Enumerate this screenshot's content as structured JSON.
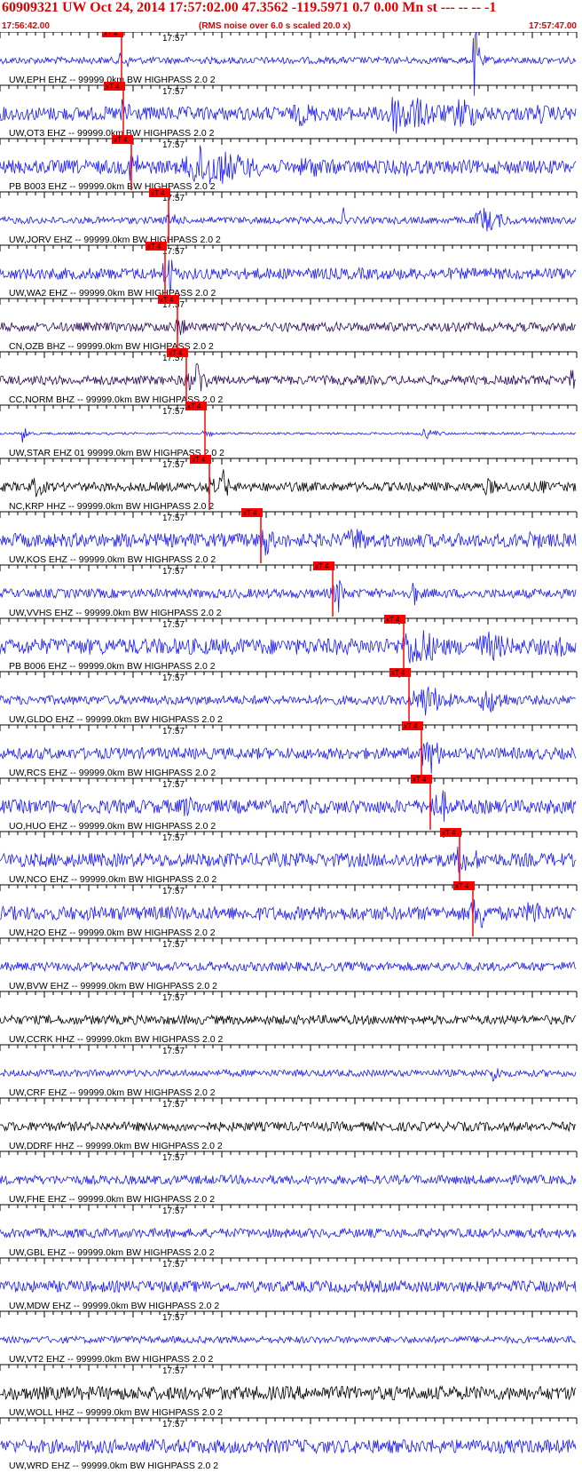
{
  "header": {
    "title": "60909321 UW Oct 24, 2014 17:57:02.00   47.3562 -119.5971  0.7 0.00 Mn st --- -- --  -1",
    "start_time": "17:56:42.00",
    "note": "(RMS noise over 6.0 s scaled 20.0 x)",
    "end_time": "17:57:47.00"
  },
  "chart_data": {
    "type": "line",
    "title": "60909321 UW Oct 24, 2014 17:57:02.00   47.3562 -119.5971  0.7 0.00 Mn st --- -- --  -1",
    "x_unit": "seconds after 17:56:42.00",
    "x_range": [
      0,
      65
    ],
    "minute_tick_label": "17:57",
    "minute_tick_offset_s": 18,
    "pick_label": "xT 4",
    "colors": {
      "blue": "#1a1aff",
      "red": "#ff0000",
      "black": "#000000",
      "purple": "#2a0a5a"
    },
    "traces": [
      {
        "label": "UW,EPH EHZ -- 99999.0km BW  HIGHPASS  2.0  2",
        "color": "blue",
        "pick_s": 13.7,
        "amplitude": 0.15,
        "bursts": [
          [
            53.5,
            0.5,
            1.8
          ]
        ]
      },
      {
        "label": "UW,OT3 EHZ -- 99999.0km BW  HIGHPASS  2.0  2",
        "color": "blue",
        "pick_s": 13.9,
        "amplitude": 0.3,
        "bursts": [
          [
            34,
            3.5,
            0.55
          ],
          [
            45,
            5,
            1.0
          ],
          [
            52,
            3,
            0.8
          ],
          [
            61,
            3,
            0.45
          ]
        ]
      },
      {
        "label": "PB B003 EHZ -- 99999.0km BW  HIGHPASS  2.0  2",
        "color": "blue",
        "pick_s": 14.8,
        "amplitude": 0.3,
        "bursts": [
          [
            23,
            6,
            1.0
          ],
          [
            35,
            5,
            0.5
          ],
          [
            46,
            4,
            0.4
          ]
        ]
      },
      {
        "label": "UW,JORV EHZ -- 99999.0km BW  HIGHPASS  2.0  2",
        "color": "blue",
        "pick_s": 19.0,
        "amplitude": 0.15,
        "bursts": [
          [
            19.5,
            0.6,
            0.5
          ],
          [
            38.7,
            0.3,
            0.6
          ],
          [
            54.5,
            2.5,
            0.6
          ]
        ]
      },
      {
        "label": "UW,WA2 EHZ -- 99999.0km BW  HIGHPASS  2.0  2",
        "color": "blue",
        "pick_s": 18.6,
        "amplitude": 0.25,
        "bursts": [
          [
            19,
            0.5,
            1.3
          ]
        ]
      },
      {
        "label": "CN,OZB BHZ -- 99999.0km BW  HIGHPASS  2.0  2",
        "color": "purple",
        "pick_s": 20.0,
        "amplitude": 0.2,
        "bursts": []
      },
      {
        "label": "CC,NORM BHZ -- 99999.0km BW  HIGHPASS  2.0  2",
        "color": "purple",
        "pick_s": 21.0,
        "amplitude": 0.2,
        "bursts": [
          [
            22.3,
            0.9,
            1.0
          ],
          [
            64.5,
            0.6,
            0.8
          ]
        ]
      },
      {
        "label": "UW,STAR EHZ 01 99999.0km BW  HIGHPASS  2.0  2",
        "color": "blue",
        "pick_s": 23.1,
        "amplitude": 0.05,
        "bursts": [
          [
            2.6,
            0.5,
            0.5
          ],
          [
            48,
            1.5,
            0.25
          ]
        ]
      },
      {
        "label": "NC,KRP HHZ -- 99999.0km BW  HIGHPASS  2.0  2",
        "color": "black",
        "pick_s": 23.6,
        "amplitude": 0.2,
        "bursts": [
          [
            4,
            1.5,
            0.5
          ],
          [
            25,
            0.6,
            1.1
          ],
          [
            55,
            2,
            0.4
          ],
          [
            61,
            0.6,
            0.5
          ]
        ]
      },
      {
        "label": "UW,KOS EHZ -- 99999.0km BW  HIGHPASS  2.0  2",
        "color": "blue",
        "pick_s": 29.4,
        "amplitude": 0.3,
        "bursts": [
          [
            30,
            1,
            0.8
          ],
          [
            40,
            3,
            0.6
          ],
          [
            60,
            3,
            0.45
          ]
        ]
      },
      {
        "label": "UW,VVHS EHZ -- 99999.0km BW  HIGHPASS  2.0  2",
        "color": "blue",
        "pick_s": 37.5,
        "amplitude": 0.2,
        "bursts": [
          [
            38,
            0.6,
            1.1
          ],
          [
            46.5,
            0.5,
            0.9
          ]
        ]
      },
      {
        "label": "PB B006 EHZ -- 99999.0km BW  HIGHPASS  2.0  2",
        "color": "blue",
        "pick_s": 45.5,
        "amplitude": 0.35,
        "bursts": [
          [
            11,
            0.5,
            0.6
          ],
          [
            47,
            3,
            1.0
          ],
          [
            55,
            4,
            0.7
          ],
          [
            63,
            2,
            0.5
          ]
        ]
      },
      {
        "label": "UW,GLDO EHZ -- 99999.0km BW  HIGHPASS  2.0  2",
        "color": "blue",
        "pick_s": 46.1,
        "amplitude": 0.2,
        "bursts": [
          [
            48,
            2.5,
            0.8
          ],
          [
            55,
            2.5,
            0.65
          ]
        ]
      },
      {
        "label": "UW,RCS EHZ -- 99999.0km BW  HIGHPASS  2.0  2",
        "color": "blue",
        "pick_s": 47.5,
        "amplitude": 0.25,
        "bursts": [
          [
            48.5,
            1.2,
            1.0
          ]
        ]
      },
      {
        "label": "UO,HUO EHZ -- 99999.0km BW  HIGHPASS  2.0  2",
        "color": "blue",
        "pick_s": 48.5,
        "amplitude": 0.3,
        "bursts": [
          [
            21,
            3,
            0.5
          ],
          [
            50,
            0.8,
            0.8
          ]
        ]
      },
      {
        "label": "UW,NCO EHZ -- 99999.0km BW  HIGHPASS  2.0  2",
        "color": "blue",
        "pick_s": 51.8,
        "amplitude": 0.3,
        "bursts": [
          [
            53.5,
            0.8,
            0.6
          ]
        ]
      },
      {
        "label": "UW,H2O EHZ -- 99999.0km BW  HIGHPASS  2.0  2",
        "color": "blue",
        "pick_s": 53.3,
        "amplitude": 0.3,
        "bursts": [
          [
            54,
            1,
            1.0
          ],
          [
            60,
            2,
            0.7
          ]
        ]
      },
      {
        "label": "UW,BVW EHZ -- 99999.0km BW  HIGHPASS  2.0  2",
        "color": "blue",
        "pick_s": null,
        "amplitude": 0.2,
        "bursts": []
      },
      {
        "label": "UW,CCRK HHZ -- 99999.0km BW  HIGHPASS  2.0  2",
        "color": "black",
        "pick_s": null,
        "amplitude": 0.2,
        "bursts": []
      },
      {
        "label": "UW,CRF EHZ -- 99999.0km BW  HIGHPASS  2.0  2",
        "color": "blue",
        "pick_s": null,
        "amplitude": 0.15,
        "bursts": [
          [
            55.5,
            0.8,
            0.6
          ]
        ]
      },
      {
        "label": "UW,DDRF HHZ -- 99999.0km BW  HIGHPASS  2.0  2",
        "color": "black",
        "pick_s": null,
        "amplitude": 0.2,
        "bursts": []
      },
      {
        "label": "UW,FHE EHZ -- 99999.0km BW  HIGHPASS  2.0  2",
        "color": "blue",
        "pick_s": null,
        "amplitude": 0.2,
        "bursts": []
      },
      {
        "label": "UW,GBL EHZ -- 99999.0km BW  HIGHPASS  2.0  2",
        "color": "blue",
        "pick_s": null,
        "amplitude": 0.2,
        "bursts": []
      },
      {
        "label": "UW,MDW EHZ -- 99999.0km BW  HIGHPASS  2.0  2",
        "color": "blue",
        "pick_s": null,
        "amplitude": 0.25,
        "bursts": []
      },
      {
        "label": "UW,VT2 EHZ -- 99999.0km BW  HIGHPASS  2.0  2",
        "color": "blue",
        "pick_s": null,
        "amplitude": 0.15,
        "bursts": []
      },
      {
        "label": "UW,WOLL HHZ -- 99999.0km BW  HIGHPASS  2.0  2",
        "color": "black",
        "pick_s": null,
        "amplitude": 0.3,
        "bursts": [
          [
            37,
            1.5,
            0.4
          ]
        ]
      },
      {
        "label": "UW,WRD EHZ -- 99999.0km BW  HIGHPASS  2.0  2",
        "color": "blue",
        "pick_s": null,
        "amplitude": 0.3,
        "bursts": []
      }
    ]
  }
}
